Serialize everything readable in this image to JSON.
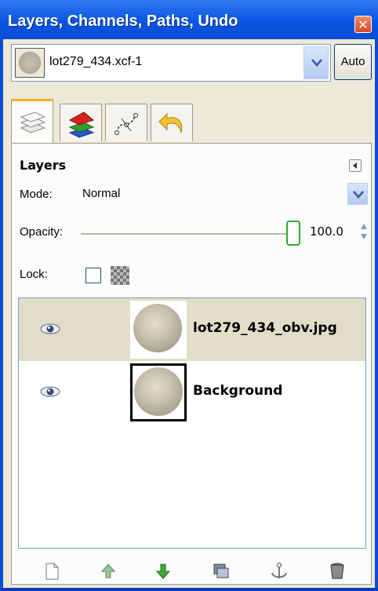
{
  "window": {
    "title": "Layers, Channels, Paths, Undo"
  },
  "image_selector": {
    "value": "lot279_434.xcf-1",
    "auto_label": "Auto"
  },
  "tabs": [
    {
      "icon": "layers-icon"
    },
    {
      "icon": "channels-icon"
    },
    {
      "icon": "paths-icon"
    },
    {
      "icon": "undo-icon"
    }
  ],
  "layers_panel": {
    "title": "Layers",
    "mode_label": "Mode:",
    "mode_value": "Normal",
    "opacity_label": "Opacity:",
    "opacity_value": "100.0",
    "lock_label": "Lock:",
    "layers": [
      {
        "name": "lot279_434_obv.jpg",
        "visible": true,
        "selected": true
      },
      {
        "name": "Background",
        "visible": true,
        "selected": false
      }
    ]
  },
  "bottom_buttons": [
    {
      "icon": "new-layer-icon"
    },
    {
      "icon": "raise-layer-icon"
    },
    {
      "icon": "lower-layer-icon"
    },
    {
      "icon": "duplicate-layer-icon"
    },
    {
      "icon": "anchor-layer-icon"
    },
    {
      "icon": "delete-layer-icon"
    }
  ],
  "colors": {
    "titlebar": "#0a55e0",
    "panel_bg": "#ece9d8",
    "selected_row": "#e2ddc8"
  }
}
